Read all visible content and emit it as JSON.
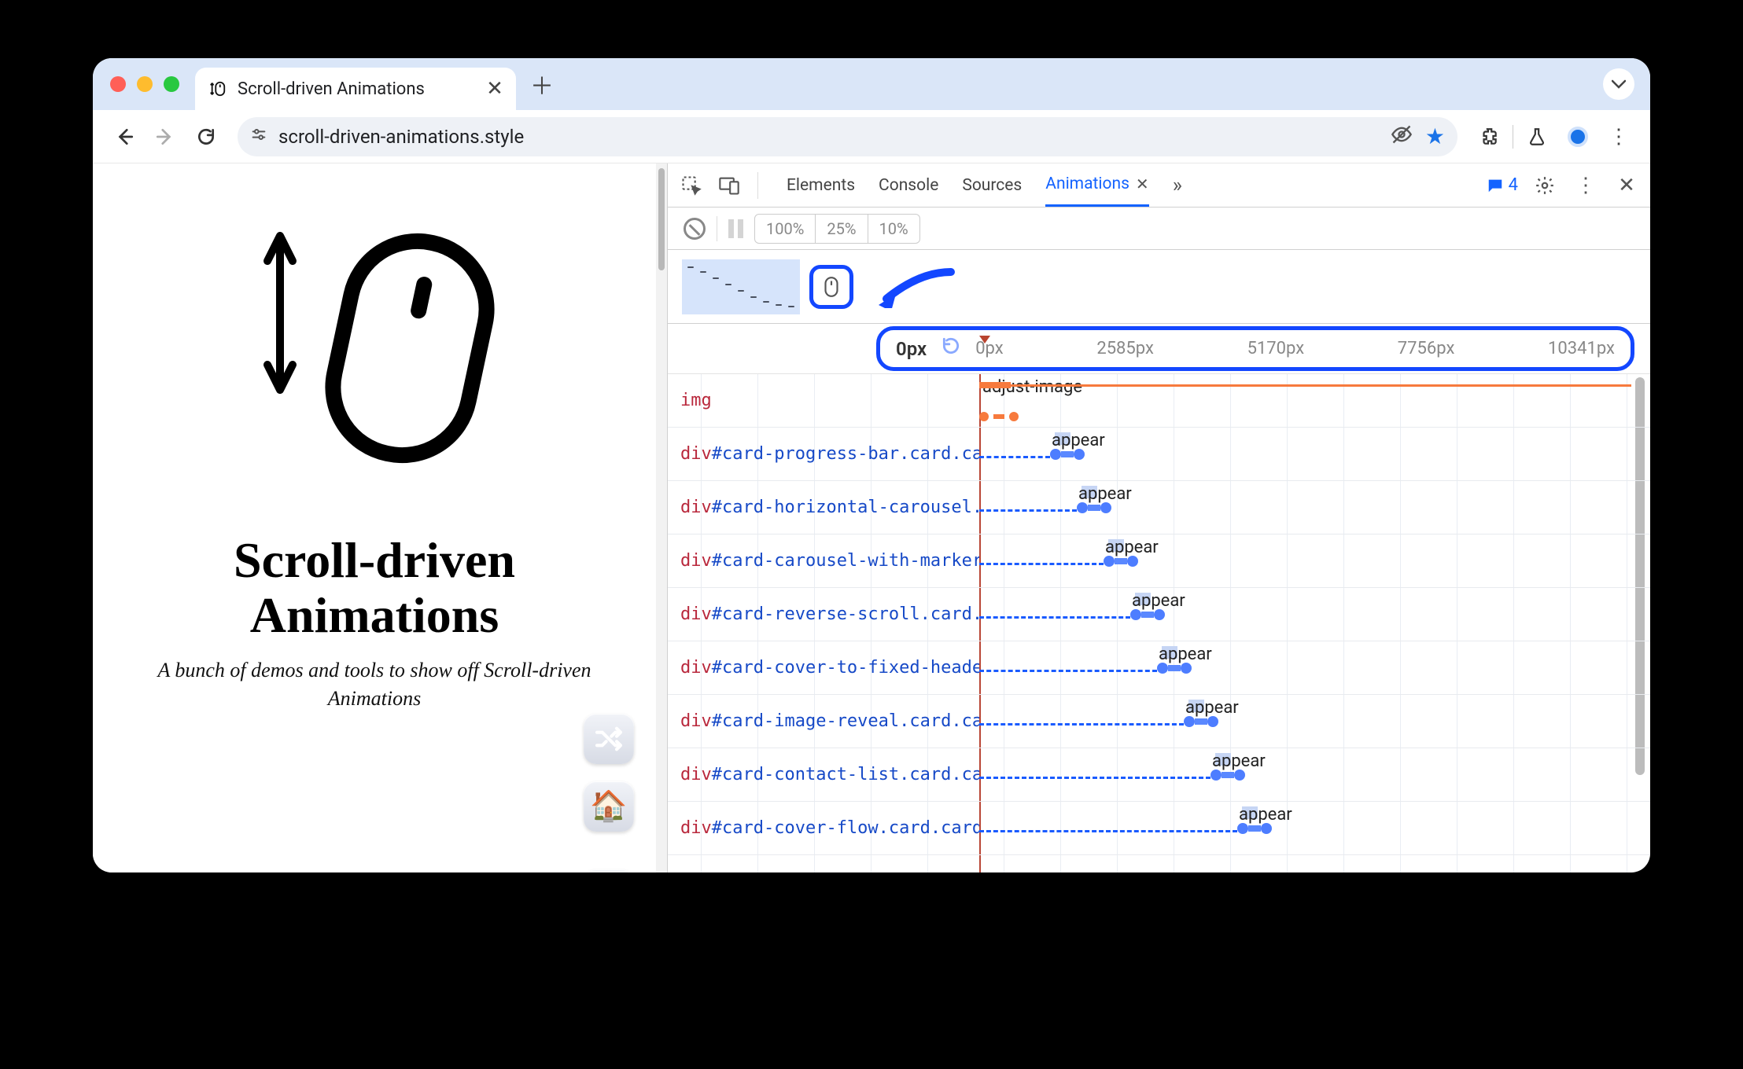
{
  "browser": {
    "tab_title": "Scroll-driven Animations",
    "url": "scroll-driven-animations.style"
  },
  "page": {
    "title_line1": "Scroll-driven",
    "title_line2": "Animations",
    "subtitle": "A bunch of demos and tools to show off Scroll-driven Animations"
  },
  "devtools": {
    "tabs": [
      "Elements",
      "Console",
      "Sources",
      "Animations"
    ],
    "active_tab": "Animations",
    "message_count": "4",
    "speeds": [
      "100%",
      "25%",
      "10%"
    ],
    "ruler": {
      "current": "0px",
      "ticks": [
        "0px",
        "2585px",
        "5170px",
        "7756px",
        "10341px"
      ]
    },
    "rows": [
      {
        "type": "img",
        "label_tag": "img",
        "label_rest": "",
        "anim": "adjust-image",
        "offset": 0,
        "color": "orange"
      },
      {
        "type": "div",
        "label_tag": "div",
        "label_id": "#card-progress-bar",
        "label_cls": ".card.ca",
        "anim": "appear",
        "offset": 90
      },
      {
        "type": "div",
        "label_tag": "div",
        "label_id": "#card-horizontal-carousel",
        "label_cls": ".",
        "anim": "appear",
        "offset": 124
      },
      {
        "type": "div",
        "label_tag": "div",
        "label_id": "#card-carousel-with-marker",
        "label_cls": "",
        "anim": "appear",
        "offset": 158
      },
      {
        "type": "div",
        "label_tag": "div",
        "label_id": "#card-reverse-scroll",
        "label_cls": ".card.",
        "anim": "appear",
        "offset": 192
      },
      {
        "type": "div",
        "label_tag": "div",
        "label_id": "#card-cover-to-fixed-heade",
        "label_cls": "",
        "anim": "appear",
        "offset": 226
      },
      {
        "type": "div",
        "label_tag": "div",
        "label_id": "#card-image-reveal",
        "label_cls": ".card.ca",
        "anim": "appear",
        "offset": 260
      },
      {
        "type": "div",
        "label_tag": "div",
        "label_id": "#card-contact-list",
        "label_cls": ".card.ca",
        "anim": "appear",
        "offset": 294
      },
      {
        "type": "div",
        "label_tag": "div",
        "label_id": "#card-cover-flow",
        "label_cls": ".card.card",
        "anim": "appear",
        "offset": 328
      }
    ]
  }
}
